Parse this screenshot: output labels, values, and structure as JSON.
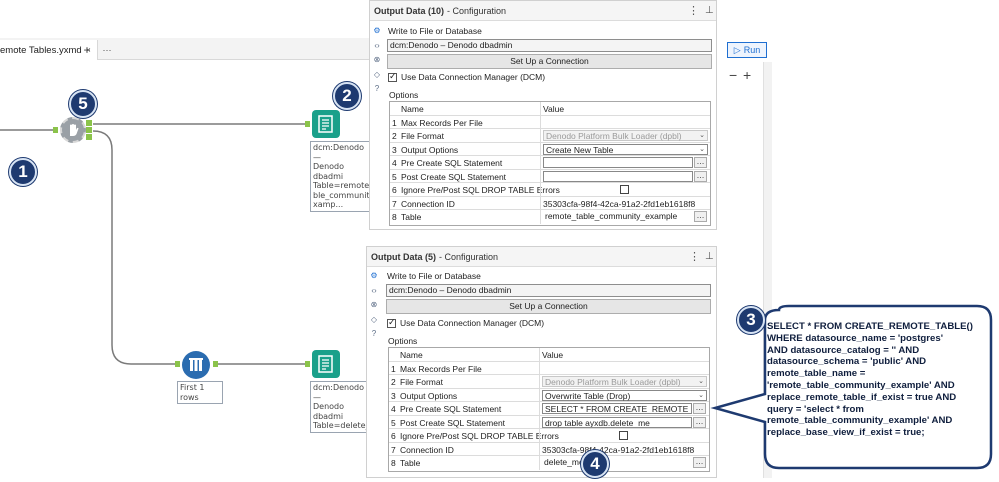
{
  "workflow": {
    "tab_title": "emote Tables.yxmd",
    "tab_close": "×",
    "tab_add": "+",
    "tab_more": "···",
    "run_label": "Run",
    "zoom_out": "−",
    "zoom_in": "+",
    "node_1_label": [
      "dcm:Denodo —",
      "Denodo dbadmi",
      "Table=remote_ta",
      "ble_community_",
      "xamp..."
    ],
    "node_2_label": [
      "dcm:Denodo —",
      "Denodo dbadmi",
      "Table=delete_me"
    ],
    "sample_label": "First 1 rows"
  },
  "badges": [
    "1",
    "2",
    "3",
    "4",
    "5"
  ],
  "panel_top": {
    "title_bold": "Output Data (10)",
    "title_rest": " - Configuration",
    "write_label": "Write to File or Database",
    "connection": "dcm:Denodo – Denodo dbadmin",
    "setup_button": "Set Up a Connection",
    "dcm_label": "Use Data Connection Manager (DCM)",
    "options_label": "Options",
    "col_name": "Name",
    "col_value": "Value",
    "rows": [
      {
        "num": "1",
        "name": "Max Records Per File",
        "value": ""
      },
      {
        "num": "2",
        "name": "File Format",
        "value": "Denodo Platform Bulk Loader (dpbl)"
      },
      {
        "num": "3",
        "name": "Output Options",
        "value": "Create New Table"
      },
      {
        "num": "4",
        "name": "Pre Create SQL Statement",
        "value": ""
      },
      {
        "num": "5",
        "name": "Post Create SQL Statement",
        "value": ""
      },
      {
        "num": "6",
        "name": "Ignore Pre/Post SQL DROP TABLE Errors",
        "value": ""
      },
      {
        "num": "7",
        "name": "Connection ID",
        "value": "35303cfa-98f4-42ca-91a2-2fd1eb1618f8"
      },
      {
        "num": "8",
        "name": "Table",
        "value": "remote_table_community_example"
      }
    ]
  },
  "panel_bottom": {
    "title_bold": "Output Data (5)",
    "title_rest": " - Configuration",
    "write_label": "Write to File or Database",
    "connection": "dcm:Denodo – Denodo dbadmin",
    "setup_button": "Set Up a Connection",
    "dcm_label": "Use Data Connection Manager (DCM)",
    "options_label": "Options",
    "col_name": "Name",
    "col_value": "Value",
    "rows": [
      {
        "num": "1",
        "name": "Max Records Per File",
        "value": ""
      },
      {
        "num": "2",
        "name": "File Format",
        "value": "Denodo Platform Bulk Loader (dpbl)"
      },
      {
        "num": "3",
        "name": "Output Options",
        "value": "Overwrite Table (Drop)"
      },
      {
        "num": "4",
        "name": "Pre Create SQL Statement",
        "value": "SELECT * FROM CREATE_REMOTE_TA..."
      },
      {
        "num": "5",
        "name": "Post Create SQL Statement",
        "value": "drop table ayxdb.delete_me"
      },
      {
        "num": "6",
        "name": "Ignore Pre/Post SQL DROP TABLE Errors",
        "value": ""
      },
      {
        "num": "7",
        "name": "Connection ID",
        "value": "35303cfa-98f4-42ca-91a2-2fd1eb1618f8"
      },
      {
        "num": "8",
        "name": "Table",
        "value": "delete_me"
      }
    ]
  },
  "callout": {
    "lines": [
      "SELECT * FROM CREATE_REMOTE_TABLE()",
      "WHERE datasource_name = 'postgres'",
      "AND datasource_catalog = '' AND",
      "datasource_schema = 'public' AND",
      "remote_table_name =",
      "'remote_table_community_example' AND",
      "replace_remote_table_if_exist = true AND",
      "query = 'select * from",
      "remote_table_community_example' AND",
      "replace_base_view_if_exist = true;"
    ]
  },
  "colors": {
    "badge": "#1e3a70",
    "accent": "#1f6fd1",
    "connector": "#8bc34a",
    "output_tool": "#1aa08a",
    "sample_tool": "#2b6cb0"
  }
}
